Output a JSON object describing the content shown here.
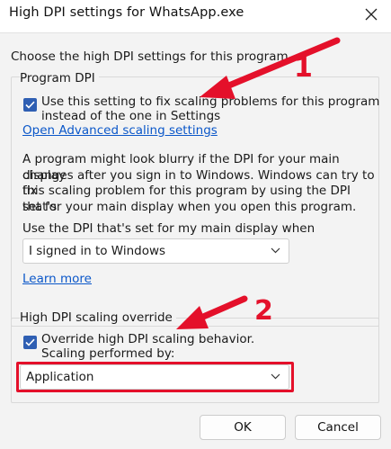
{
  "window": {
    "title": "High DPI settings for WhatsApp.exe"
  },
  "intro_text": "Choose the high DPI settings for this program.",
  "program_dpi": {
    "group_title": "Program DPI",
    "checkbox_checked": true,
    "checkbox_label_line1": "Use this setting to fix scaling problems for this program",
    "checkbox_label_line2": "instead of the one in Settings",
    "advanced_link": "Open Advanced scaling settings",
    "description_lines": [
      "A program might look blurry if the DPI for your main display",
      "changes after you sign in to Windows. Windows can try to fix",
      "this scaling problem for this program by using the DPI that's",
      "set for your main display when you open this program."
    ],
    "dropdown_label": "Use the DPI that's set for my main display when",
    "dropdown_value": "I signed in to Windows",
    "learn_more": "Learn more"
  },
  "override": {
    "group_title": "High DPI scaling override",
    "checkbox_checked": true,
    "checkbox_label_line1": "Override high DPI scaling behavior.",
    "checkbox_label_line2": "Scaling performed by:",
    "dropdown_value": "Application"
  },
  "buttons": {
    "ok": "OK",
    "cancel": "Cancel"
  },
  "annotations": {
    "marker_1": "1",
    "marker_2": "2",
    "color": "#e4102a"
  },
  "icons": {
    "close": "close-icon",
    "checkmark": "checkmark-icon",
    "chevron": "chevron-down-icon"
  }
}
